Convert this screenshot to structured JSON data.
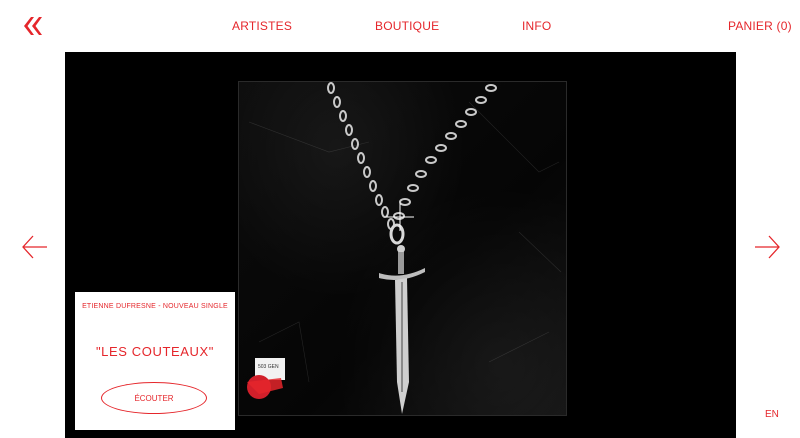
{
  "brand": {
    "accent": "#e5262b",
    "logo_icon": "double-chevron-logo"
  },
  "nav": {
    "artists": "ARTISTES",
    "shop": "BOUTIQUE",
    "info": "INFO",
    "cart": "PANIER (0)"
  },
  "slide": {
    "image_alt": "Pendentif épée sur chaîne en argent sur fond noir",
    "sticker_code": "503 GEN",
    "promo": {
      "kicker": "ETIENNE DUFRESNE - NOUVEAU SINGLE",
      "title": "\"LES COUTEAUX\"",
      "cta": "ÉCOUTER"
    }
  },
  "controls": {
    "prev_icon": "arrow-left-icon",
    "next_icon": "arrow-right-icon"
  },
  "language": "EN"
}
